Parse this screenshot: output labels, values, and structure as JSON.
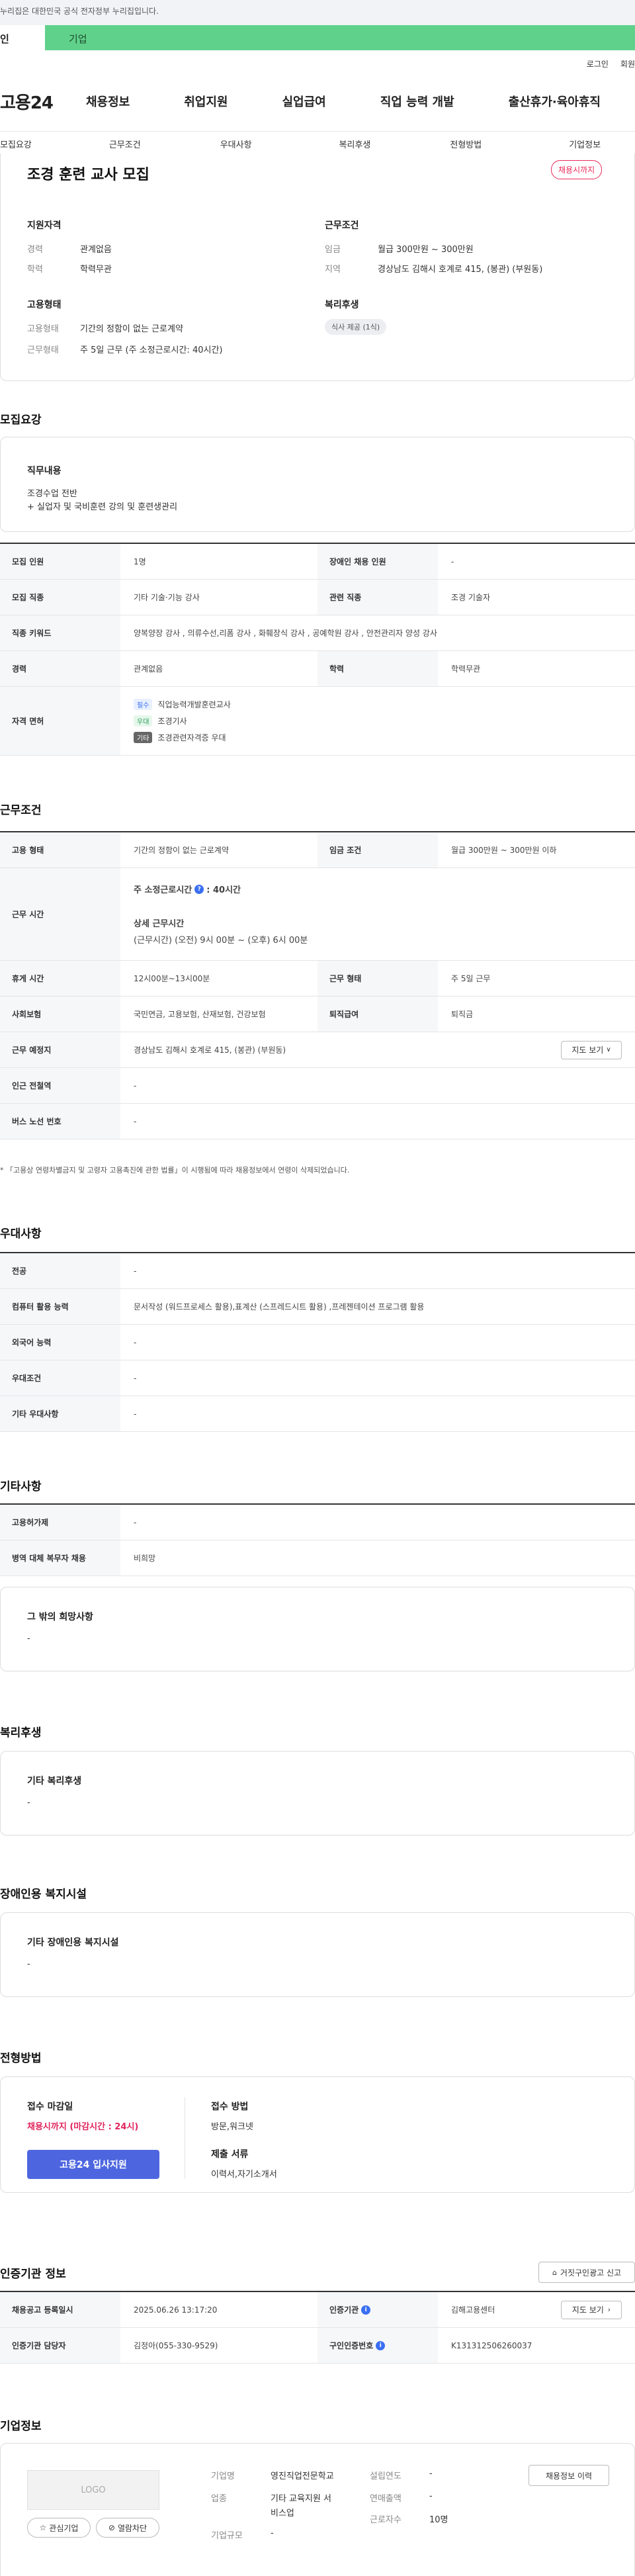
{
  "header": {
    "top_notice": "누리집은 대한민국 공식 전자정부 누리집입니다.",
    "tab_person": "인",
    "tab_company": "기업",
    "util_links": [
      "로그인",
      "회원"
    ],
    "logo": "고용24",
    "gnb": [
      "채용정보",
      "취업지원",
      "실업급여",
      "직업 능력 개발",
      "출산휴가·육아휴직"
    ],
    "lnb": [
      "모집요강",
      "근무조건",
      "우대사항",
      "복리후생",
      "전형방법",
      "기업정보"
    ]
  },
  "summary": {
    "title": "조경 훈련 교사 모집",
    "badge": "채용시까지",
    "qualification_title": "지원자격",
    "career_label": "경력",
    "career_value": "관계없음",
    "education_label": "학력",
    "education_value": "학력무관",
    "conditions_title": "근무조건",
    "wage_label": "임금",
    "wage_value": "월급 300만원 ~ 300만원",
    "region_label": "지역",
    "region_value": "경상남도 김해시 호계로 415, (봉관) (부원동)",
    "employment_title": "고용형태",
    "emp_type_label": "고용형태",
    "emp_type_value": "기간의 정함이 없는 근로계약",
    "work_type_label": "근무형태",
    "work_type_value": "주 5일 근무 (주 소정근로시간: 40시간)",
    "welfare_title": "복리후생",
    "welfare_chip": "식사 제공 (1식)"
  },
  "recruit": {
    "section_title": "모집요강",
    "duty_title": "직무내용",
    "duty_lines": [
      "조경수업 전반",
      "+ 실업자 및 국비훈련 강의 및 훈련생관리"
    ],
    "r_count_label": "모집 인원",
    "r_count_value": "1명",
    "r_disabled_label": "장애인 채용 인원",
    "r_disabled_value": "-",
    "r_job_label": "모집 직종",
    "r_job_value": "기타 기술·기능 강사",
    "r_related_label": "관련 직종",
    "r_related_value": "조경 기술자",
    "r_keyword_label": "직종 키워드",
    "r_keyword_value": "양복양장 강사 , 의류수선,리폼 강사 , 화훼장식 강사 , 공예학원 강사 , 안전관리자 양성 강사",
    "r_career_label": "경력",
    "r_career_value": "관계없음",
    "r_edu_label": "학력",
    "r_edu_value": "학력무관",
    "r_license_label": "자격 면허",
    "licenses": [
      {
        "tag": "필수",
        "name": "직업능력개발훈련교사"
      },
      {
        "tag": "우대",
        "name": "조경기사"
      },
      {
        "tag": "기타",
        "name": "조경관련자격증 우대"
      }
    ]
  },
  "work": {
    "section_title": "근무조건",
    "w_type_label": "고용 형태",
    "w_type_value": "기간의 정함이 없는 근로계약",
    "w_wage_label": "임금 조건",
    "w_wage_value": "월급 300만원 ~ 300만원 이하",
    "w_hours_label": "근무 시간",
    "w_hours_weekly_label": "주 소정근로시간",
    "w_hours_weekly_value": ": 40시간",
    "w_hours_detail_label": "상세 근무시간",
    "w_hours_detail_value": "(근무시간) (오전) 9시 00분 ~ (오후) 6시 00분",
    "w_break_label": "휴게 시간",
    "w_break_value": "12시00분~13시00분",
    "w_form_label": "근무 형태",
    "w_form_value": "주 5일 근무",
    "w_insurance_label": "사회보험",
    "w_insurance_value": "국민연금, 고용보험, 산재보험, 건강보험",
    "w_retire_label": "퇴직급여",
    "w_retire_value": "퇴직금",
    "w_place_label": "근무 예정지",
    "w_place_value": "경상남도 김해시 호계로 415, (봉관) (부원동)",
    "map_btn": "지도 보기",
    "w_subway_label": "인근 전철역",
    "w_subway_value": "-",
    "w_bus_label": "버스 노선 번호",
    "w_bus_value": "-",
    "note": "* 「고용상 연령차별금지 및 고령자 고용촉진에 관한 법률」이 시행됨에 따라 채용정보에서 연령이 삭제되었습니다."
  },
  "prefer": {
    "section_title": "우대사항",
    "p_major_label": "전공",
    "p_major_value": "-",
    "p_pc_label": "컴퓨터 활용 능력",
    "p_pc_value": "문서작성 (워드프로세스 활용),표계산 (스프레드시트 활용) ,프레젠테이션 프로그램 활용",
    "p_lang_label": "외국어 능력",
    "p_lang_value": "-",
    "p_cond_label": "우대조건",
    "p_cond_value": "-",
    "p_other_label": "기타 우대사항",
    "p_other_value": "-"
  },
  "etc": {
    "section_title": "기타사항",
    "e_permit_label": "고용허가제",
    "e_permit_value": "-",
    "e_military_label": "병역 대체 복무자 채용",
    "e_military_value": "비희망",
    "e_other_title": "그 밖의 희망사항",
    "e_other_value": "-"
  },
  "welfare": {
    "section_title": "복리후생",
    "card_title": "기타 복리후생",
    "card_value": "-"
  },
  "disabled": {
    "section_title": "장애인용 복지시설",
    "card_title": "기타 장애인용 복지시설",
    "card_value": "-"
  },
  "process": {
    "section_title": "전형방법",
    "deadline_label": "접수 마감일",
    "deadline_value": "채용시까지 (마감시간 : 24시)",
    "apply_btn": "고용24 입사지원",
    "method_label": "접수 방법",
    "method_value": "방문,워크넷",
    "docs_label": "제출 서류",
    "docs_value": "이력서,자기소개서"
  },
  "cert": {
    "section_title": "인증기관 정보",
    "report_btn": "거짓구인광고 신고",
    "c_date_label": "채용공고 등록일시",
    "c_date_value": "2025.06.26 13:17:20",
    "c_org_label": "인증기관",
    "c_org_value": "김해고용센터",
    "map_btn": "지도 보기",
    "c_manager_label": "인증기관 담당자",
    "c_manager_value": "김정아(055-330-9529)",
    "c_number_label": "구인인증번호",
    "c_number_value": "K131312506260037"
  },
  "company": {
    "section_title": "기업정보",
    "logo_text": "LOGO",
    "fav_btn": "관심기업",
    "block_btn": "열람차단",
    "history_btn": "채용정보 이력",
    "name_label": "기업명",
    "name_value": "영진직업전문학교",
    "industry_label": "업종",
    "industry_value_1": "기타 교육지원 서",
    "industry_value_2": "비스업",
    "size_label": "기업규모",
    "size_value": "-",
    "founded_label": "설립연도",
    "founded_value": "-",
    "sales_label": "연매출액",
    "sales_value": "-",
    "employees_label": "근로자수",
    "employees_value": "10명"
  }
}
